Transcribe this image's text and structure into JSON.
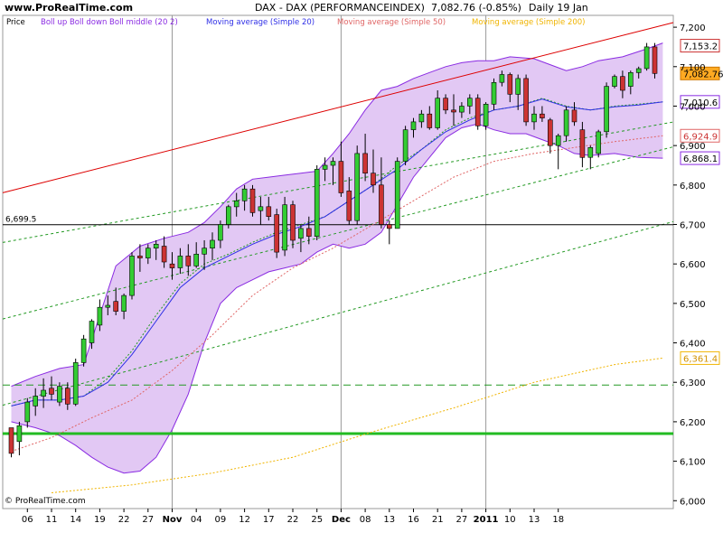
{
  "header": {
    "site": "www.ProRealTime.com",
    "instrument": "DAX - DAX (PERFORMANCEINDEX)",
    "last": "7,082.76 (-0.85%)",
    "period": "Daily  19 Jan"
  },
  "legend": {
    "price": "Price",
    "boll": "Boll up Boll down Boll middle (20 2)",
    "ma20": "Moving average (Simple 20)",
    "ma50": "Moving average (Simple 50)",
    "ma200": "Moving average (Simple 200)"
  },
  "footer": {
    "copyright": "© ProRealTime.com"
  },
  "colors": {
    "bg": "#ffffff",
    "up": "#33cc33",
    "down": "#cc3333",
    "boll_fill": "#e2c8f4",
    "boll_line": "#8a2be2",
    "ma20": "#2e2ee6",
    "ma50": "#e06666",
    "ma200": "#f0b400",
    "trend_red": "#dd0000",
    "support": "#22bb22",
    "dash_green": "#229922"
  },
  "chart_data": {
    "type": "candlestick",
    "title": "DAX - DAX (PERFORMANCEINDEX)",
    "x_labels": [
      "06",
      "11",
      "14",
      "19",
      "22",
      "27",
      "Nov",
      "04",
      "09",
      "12",
      "17",
      "22",
      "25",
      "Dec",
      "08",
      "13",
      "16",
      "21",
      "27",
      "2011",
      "10",
      "13",
      "18"
    ],
    "x_label_positions": [
      2,
      5,
      8,
      11,
      14,
      17,
      20,
      23,
      26,
      29,
      32,
      35,
      38,
      41,
      44,
      47,
      50,
      53,
      56,
      59,
      62,
      65,
      68
    ],
    "ylim": [
      5980,
      7230
    ],
    "y_ticks": [
      6000,
      6100,
      6200,
      6300,
      6400,
      6500,
      6600,
      6700,
      6800,
      6900,
      7000,
      7100,
      7200
    ],
    "y_tick_labels": [
      "6,000",
      "6,100",
      "6,200",
      "6,300",
      "6,400",
      "6,500",
      "6,600",
      "6,700",
      "6,800",
      "6,900",
      "7,000",
      "7,100",
      "7,200"
    ],
    "month_separators": [
      20,
      41,
      59
    ],
    "horizontal_level": {
      "value": 6699.5,
      "label": "6,699.5"
    },
    "support_level": 6170,
    "dashed_level": 6293,
    "badges": [
      {
        "value": 7153.2,
        "label": "7,153.2",
        "style": "box"
      },
      {
        "value": 7082.76,
        "label": "7,082.76",
        "style": "last"
      },
      {
        "value": 7010.6,
        "label": "7,010.6",
        "style": "box"
      },
      {
        "value": 6924.9,
        "label": "6,924.9",
        "style": "red"
      },
      {
        "value": 6868.1,
        "label": "6,868.1",
        "style": "box"
      },
      {
        "value": 6361.4,
        "label": "6,361.4",
        "style": "yellow"
      }
    ],
    "candles": [
      [
        6185,
        6185,
        6110,
        6120
      ],
      [
        6150,
        6200,
        6115,
        6190
      ],
      [
        6200,
        6260,
        6185,
        6250
      ],
      [
        6240,
        6285,
        6215,
        6265
      ],
      [
        6265,
        6310,
        6235,
        6280
      ],
      [
        6285,
        6315,
        6255,
        6270
      ],
      [
        6250,
        6300,
        6240,
        6290
      ],
      [
        6285,
        6300,
        6230,
        6245
      ],
      [
        6245,
        6360,
        6240,
        6350
      ],
      [
        6350,
        6420,
        6340,
        6410
      ],
      [
        6400,
        6460,
        6385,
        6455
      ],
      [
        6445,
        6510,
        6430,
        6490
      ],
      [
        6490,
        6520,
        6470,
        6495
      ],
      [
        6505,
        6540,
        6470,
        6480
      ],
      [
        6480,
        6525,
        6460,
        6520
      ],
      [
        6520,
        6630,
        6510,
        6620
      ],
      [
        6620,
        6650,
        6580,
        6615
      ],
      [
        6615,
        6650,
        6600,
        6640
      ],
      [
        6640,
        6660,
        6610,
        6650
      ],
      [
        6645,
        6670,
        6590,
        6605
      ],
      [
        6600,
        6630,
        6560,
        6590
      ],
      [
        6590,
        6640,
        6575,
        6620
      ],
      [
        6620,
        6650,
        6570,
        6595
      ],
      [
        6595,
        6655,
        6590,
        6625
      ],
      [
        6625,
        6660,
        6585,
        6640
      ],
      [
        6640,
        6680,
        6610,
        6660
      ],
      [
        6660,
        6710,
        6640,
        6700
      ],
      [
        6700,
        6750,
        6690,
        6745
      ],
      [
        6745,
        6780,
        6720,
        6760
      ],
      [
        6760,
        6800,
        6735,
        6790
      ],
      [
        6790,
        6800,
        6720,
        6730
      ],
      [
        6735,
        6770,
        6700,
        6745
      ],
      [
        6745,
        6770,
        6710,
        6720
      ],
      [
        6725,
        6740,
        6615,
        6630
      ],
      [
        6635,
        6770,
        6620,
        6750
      ],
      [
        6750,
        6760,
        6640,
        6660
      ],
      [
        6665,
        6700,
        6630,
        6690
      ],
      [
        6690,
        6720,
        6650,
        6670
      ],
      [
        6670,
        6850,
        6660,
        6840
      ],
      [
        6840,
        6870,
        6810,
        6850
      ],
      [
        6850,
        6870,
        6800,
        6860
      ],
      [
        6860,
        6910,
        6770,
        6780
      ],
      [
        6785,
        6820,
        6700,
        6710
      ],
      [
        6710,
        6900,
        6700,
        6880
      ],
      [
        6880,
        6930,
        6810,
        6830
      ],
      [
        6830,
        6890,
        6780,
        6800
      ],
      [
        6800,
        6870,
        6690,
        6700
      ],
      [
        6700,
        6710,
        6650,
        6690
      ],
      [
        6690,
        6870,
        6690,
        6860
      ],
      [
        6860,
        6950,
        6850,
        6940
      ],
      [
        6940,
        6970,
        6920,
        6960
      ],
      [
        6960,
        6990,
        6945,
        6980
      ],
      [
        6980,
        7000,
        6940,
        6945
      ],
      [
        6945,
        7040,
        6940,
        7020
      ],
      [
        7020,
        7030,
        6980,
        6990
      ],
      [
        6990,
        7030,
        6950,
        6985
      ],
      [
        6985,
        7010,
        6970,
        7000
      ],
      [
        7000,
        7030,
        6980,
        7020
      ],
      [
        7020,
        7030,
        6940,
        6950
      ],
      [
        6950,
        7010,
        6940,
        7005
      ],
      [
        7005,
        7070,
        6990,
        7060
      ],
      [
        7060,
        7090,
        7050,
        7080
      ],
      [
        7080,
        7085,
        7010,
        7030
      ],
      [
        7030,
        7080,
        6990,
        7070
      ],
      [
        7070,
        7080,
        6950,
        6960
      ],
      [
        6960,
        7000,
        6940,
        6980
      ],
      [
        6980,
        7000,
        6960,
        6970
      ],
      [
        6965,
        6970,
        6880,
        6900
      ],
      [
        6900,
        6930,
        6840,
        6925
      ],
      [
        6925,
        7000,
        6910,
        6990
      ],
      [
        6990,
        7010,
        6950,
        6960
      ],
      [
        6940,
        6960,
        6845,
        6870
      ],
      [
        6870,
        6900,
        6840,
        6895
      ],
      [
        6880,
        6940,
        6870,
        6935
      ],
      [
        6935,
        7060,
        6920,
        7050
      ],
      [
        7050,
        7080,
        7045,
        7075
      ],
      [
        7075,
        7090,
        7020,
        7040
      ],
      [
        7050,
        7090,
        7030,
        7085
      ],
      [
        7085,
        7100,
        7070,
        7095
      ],
      [
        7095,
        7160,
        7090,
        7150
      ],
      [
        7150,
        7160,
        7070,
        7082.76
      ]
    ],
    "bollinger_upper": [
      [
        0,
        6290
      ],
      [
        3,
        6315
      ],
      [
        6,
        6335
      ],
      [
        9,
        6345
      ],
      [
        11,
        6470
      ],
      [
        13,
        6595
      ],
      [
        16,
        6645
      ],
      [
        19,
        6665
      ],
      [
        22,
        6680
      ],
      [
        24,
        6705
      ],
      [
        26,
        6745
      ],
      [
        28,
        6790
      ],
      [
        30,
        6815
      ],
      [
        32,
        6820
      ],
      [
        34,
        6825
      ],
      [
        36,
        6830
      ],
      [
        38,
        6835
      ],
      [
        40,
        6880
      ],
      [
        42,
        6930
      ],
      [
        44,
        6990
      ],
      [
        46,
        7040
      ],
      [
        48,
        7050
      ],
      [
        50,
        7070
      ],
      [
        52,
        7085
      ],
      [
        54,
        7100
      ],
      [
        56,
        7110
      ],
      [
        58,
        7115
      ],
      [
        60,
        7115
      ],
      [
        62,
        7125
      ],
      [
        65,
        7120
      ],
      [
        67,
        7105
      ],
      [
        69,
        7090
      ],
      [
        71,
        7100
      ],
      [
        73,
        7115
      ],
      [
        76,
        7125
      ],
      [
        79,
        7145
      ],
      [
        81,
        7160
      ]
    ],
    "bollinger_lower": [
      [
        0,
        6200
      ],
      [
        3,
        6185
      ],
      [
        6,
        6165
      ],
      [
        8,
        6140
      ],
      [
        10,
        6110
      ],
      [
        12,
        6085
      ],
      [
        14,
        6070
      ],
      [
        16,
        6075
      ],
      [
        18,
        6110
      ],
      [
        20,
        6180
      ],
      [
        22,
        6270
      ],
      [
        24,
        6400
      ],
      [
        26,
        6500
      ],
      [
        28,
        6540
      ],
      [
        30,
        6560
      ],
      [
        32,
        6580
      ],
      [
        34,
        6590
      ],
      [
        36,
        6600
      ],
      [
        38,
        6630
      ],
      [
        40,
        6650
      ],
      [
        42,
        6640
      ],
      [
        44,
        6650
      ],
      [
        46,
        6680
      ],
      [
        48,
        6750
      ],
      [
        50,
        6820
      ],
      [
        52,
        6870
      ],
      [
        54,
        6920
      ],
      [
        56,
        6945
      ],
      [
        58,
        6955
      ],
      [
        60,
        6940
      ],
      [
        62,
        6930
      ],
      [
        64,
        6930
      ],
      [
        66,
        6915
      ],
      [
        68,
        6900
      ],
      [
        70,
        6880
      ],
      [
        72,
        6875
      ],
      [
        75,
        6880
      ],
      [
        78,
        6870
      ],
      [
        81,
        6868.1
      ]
    ],
    "bollinger_middle": [
      [
        0,
        6240
      ],
      [
        3,
        6255
      ],
      [
        6,
        6255
      ],
      [
        9,
        6265
      ],
      [
        12,
        6310
      ],
      [
        15,
        6380
      ],
      [
        18,
        6470
      ],
      [
        21,
        6550
      ],
      [
        24,
        6600
      ],
      [
        27,
        6625
      ],
      [
        30,
        6655
      ],
      [
        33,
        6680
      ],
      [
        36,
        6700
      ],
      [
        39,
        6720
      ],
      [
        42,
        6760
      ],
      [
        45,
        6800
      ],
      [
        48,
        6850
      ],
      [
        51,
        6890
      ],
      [
        54,
        6940
      ],
      [
        57,
        6970
      ],
      [
        60,
        6990
      ],
      [
        63,
        7000
      ],
      [
        66,
        7020
      ],
      [
        69,
        7000
      ],
      [
        72,
        6990
      ],
      [
        75,
        7000
      ],
      [
        78,
        7005
      ],
      [
        81,
        7010.6
      ]
    ],
    "ma20": [
      [
        0,
        6240
      ],
      [
        3,
        6255
      ],
      [
        6,
        6255
      ],
      [
        9,
        6265
      ],
      [
        12,
        6300
      ],
      [
        15,
        6370
      ],
      [
        18,
        6455
      ],
      [
        21,
        6540
      ],
      [
        24,
        6590
      ],
      [
        27,
        6620
      ],
      [
        30,
        6650
      ],
      [
        33,
        6675
      ],
      [
        36,
        6695
      ],
      [
        39,
        6720
      ],
      [
        42,
        6760
      ],
      [
        45,
        6800
      ],
      [
        48,
        6840
      ],
      [
        51,
        6890
      ],
      [
        54,
        6935
      ],
      [
        57,
        6965
      ],
      [
        60,
        6990
      ],
      [
        63,
        7000
      ],
      [
        66,
        7018
      ],
      [
        69,
        6998
      ],
      [
        72,
        6990
      ],
      [
        75,
        6998
      ],
      [
        78,
        7003
      ],
      [
        81,
        7010.6
      ]
    ],
    "ma50": [
      [
        0,
        6125
      ],
      [
        5,
        6160
      ],
      [
        10,
        6210
      ],
      [
        15,
        6255
      ],
      [
        20,
        6330
      ],
      [
        25,
        6420
      ],
      [
        30,
        6520
      ],
      [
        35,
        6590
      ],
      [
        40,
        6640
      ],
      [
        45,
        6700
      ],
      [
        50,
        6760
      ],
      [
        55,
        6820
      ],
      [
        60,
        6860
      ],
      [
        65,
        6880
      ],
      [
        70,
        6895
      ],
      [
        75,
        6910
      ],
      [
        81,
        6924.9
      ]
    ],
    "ma200": [
      [
        5,
        6020
      ],
      [
        15,
        6040
      ],
      [
        25,
        6070
      ],
      [
        35,
        6110
      ],
      [
        45,
        6175
      ],
      [
        55,
        6235
      ],
      [
        65,
        6300
      ],
      [
        75,
        6345
      ],
      [
        81,
        6361.4
      ]
    ],
    "trend_upper": [
      [
        -5,
        6760
      ],
      [
        81,
        7205
      ]
    ],
    "trend_green_1": [
      [
        -5,
        6640
      ],
      [
        81,
        6955
      ]
    ],
    "trend_green_2": [
      [
        -5,
        6440
      ],
      [
        81,
        6890
      ]
    ],
    "trend_green_3": [
      [
        -5,
        6220
      ],
      [
        81,
        6700
      ]
    ]
  }
}
